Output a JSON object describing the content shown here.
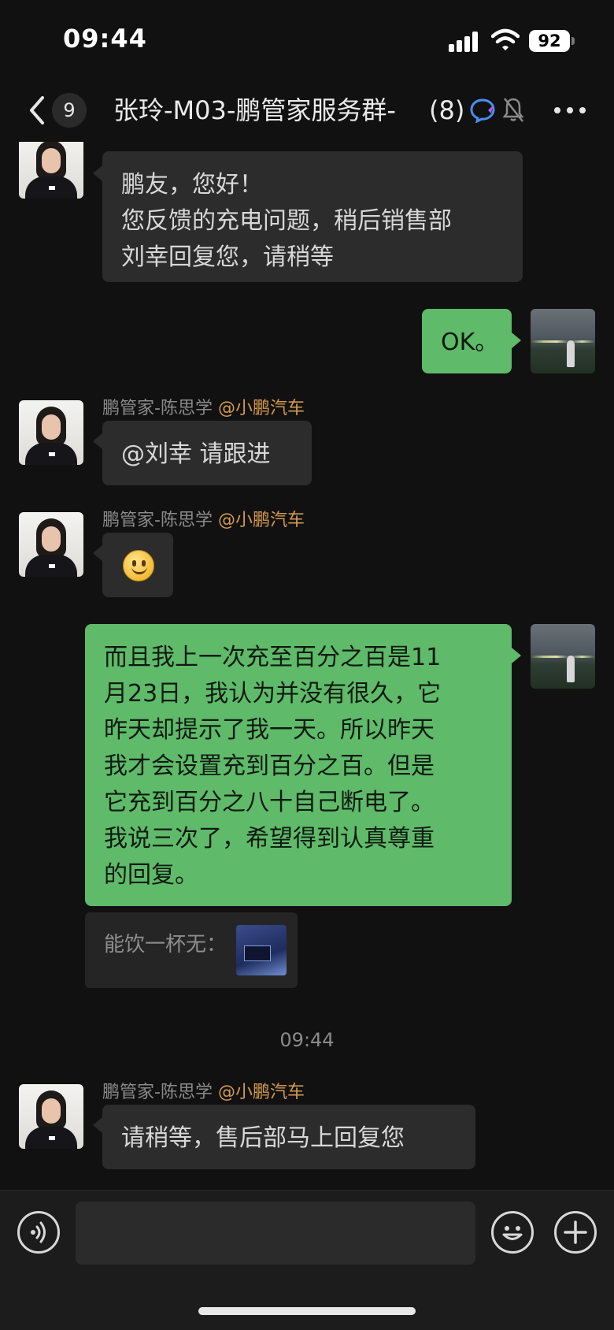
{
  "status_bar": {
    "time": "09:44",
    "battery": "92",
    "icons": [
      "signal-icon",
      "wifi-icon",
      "battery-icon"
    ]
  },
  "header": {
    "unread_count": "9",
    "title": "张玲-M03-鹏管家服务群-",
    "member_count": "(8)",
    "icons": [
      "back-icon",
      "chat-ai-icon",
      "mute-bell-icon",
      "more-icon"
    ]
  },
  "messages": [
    {
      "side": "in",
      "bubble_lines": [
        "鹏友，您好！",
        "您反馈的充电问题，稍后销售部",
        "刘幸回复您，请稍等"
      ]
    },
    {
      "side": "out",
      "text": "OK。"
    },
    {
      "side": "in",
      "sender": "鹏管家-陈思学",
      "sender_org": "@小鹏汽车",
      "text": "@刘幸 请跟进"
    },
    {
      "side": "in",
      "sender": "鹏管家-陈思学",
      "sender_org": "@小鹏汽车",
      "emoji": "smile-emoji"
    },
    {
      "side": "out",
      "lines": [
        "而且我上一次充至百分之百是11",
        "月23日，我认为并没有很久，它",
        "昨天却提示了我一天。所以昨天",
        "我才会设置充到百分之百。但是",
        "它充到百分之八十自己断电了。",
        "我说三次了，希望得到认真尊重",
        "的回复。"
      ],
      "quote": "能饮一杯无："
    },
    {
      "timestamp": "09:44"
    },
    {
      "side": "in",
      "sender": "鹏管家-陈思学",
      "sender_org": "@小鹏汽车",
      "text": "请稍等，售后部马上回复您"
    }
  ],
  "input_bar": {
    "icons": [
      "voice-icon",
      "emoji-icon",
      "plus-icon"
    ]
  },
  "colors": {
    "background": "#111111",
    "incoming_bubble": "#2c2c2c",
    "outgoing_bubble": "#5fba6a",
    "org_tag": "#d39a4e"
  }
}
